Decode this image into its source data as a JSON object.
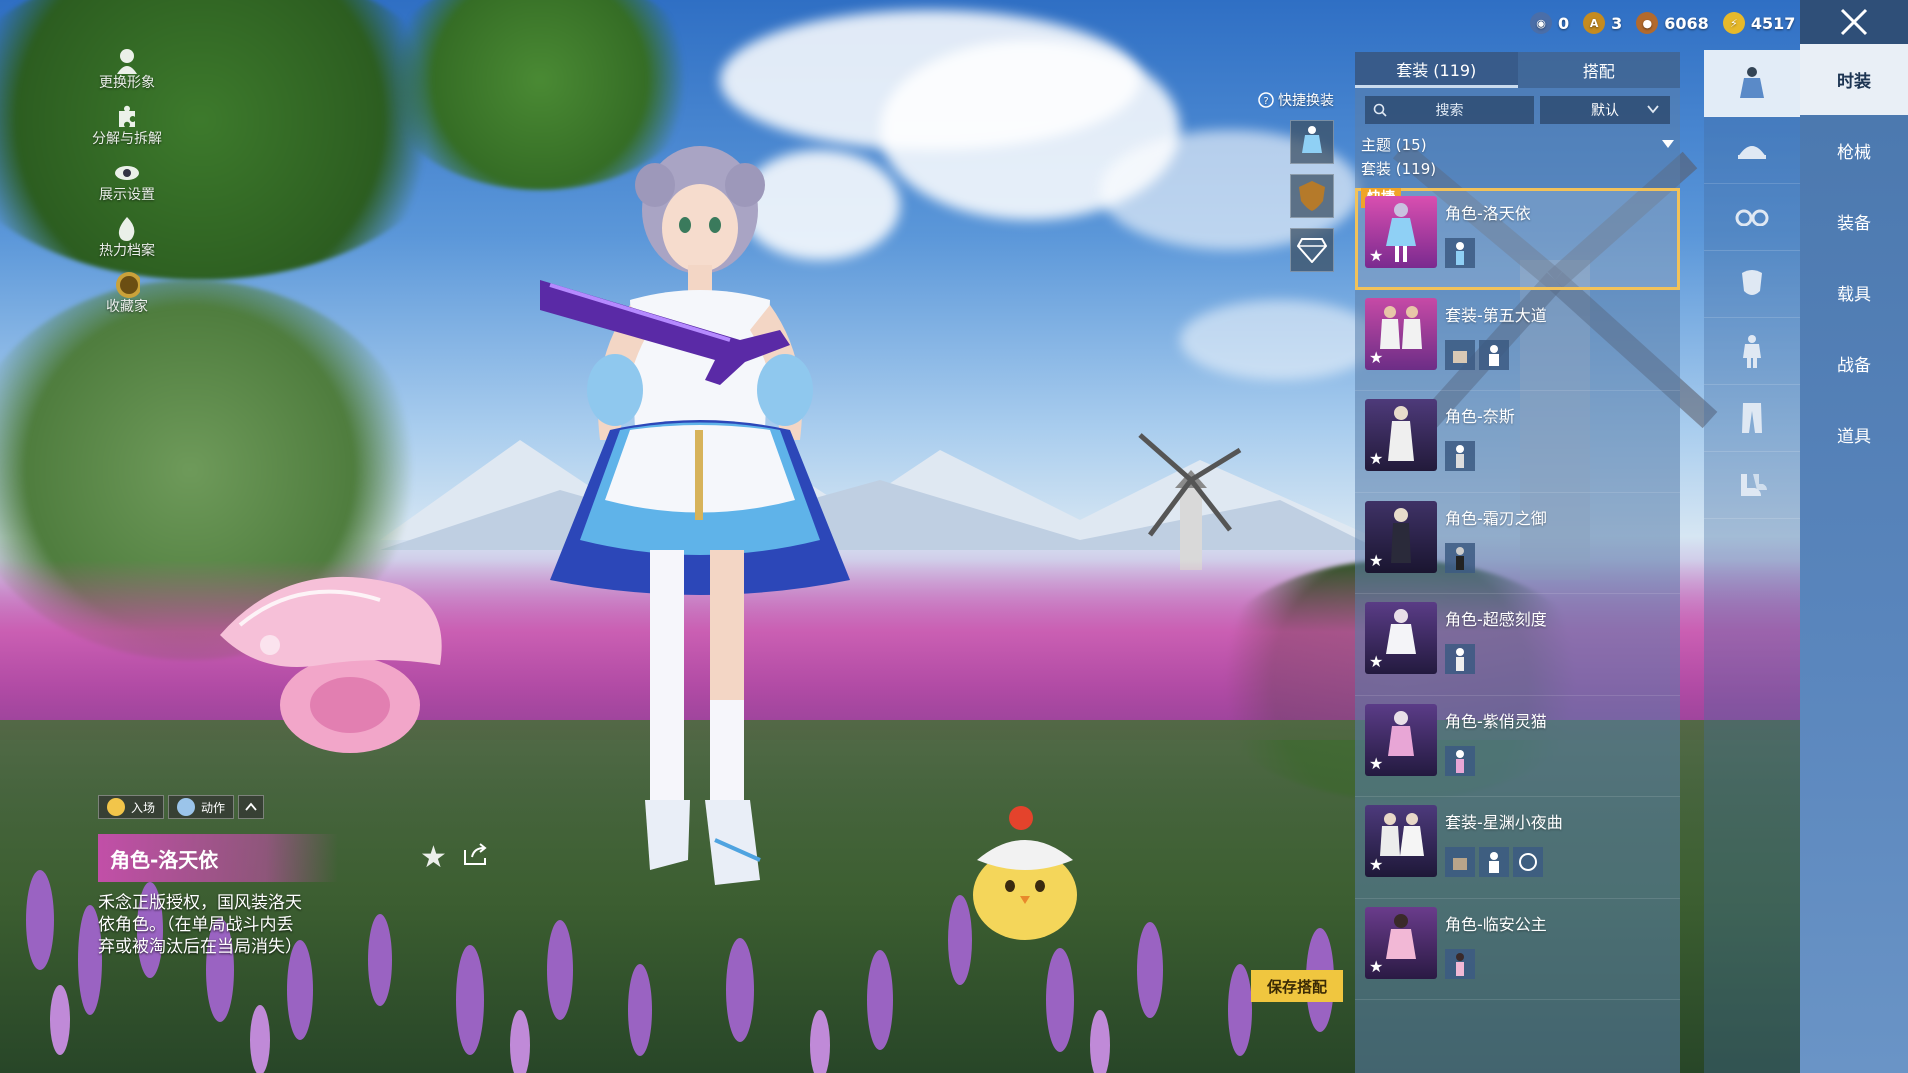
{
  "left_menu": [
    {
      "label": "更换形象",
      "icon": "person-icon"
    },
    {
      "label": "分解与拆解",
      "icon": "puzzle-icon"
    },
    {
      "label": "展示设置",
      "icon": "eye-icon"
    },
    {
      "label": "热力档案",
      "icon": "flame-icon"
    },
    {
      "label": "收藏家",
      "icon": "collector-badge-icon"
    }
  ],
  "currency": [
    {
      "value": "0",
      "icon": "globe-coin-icon",
      "color": "#4a6ea8"
    },
    {
      "value": "3",
      "icon": "a-coin-icon",
      "color": "#c58b1f"
    },
    {
      "value": "6068",
      "icon": "bronze-coin-icon",
      "color": "#b26a2d"
    },
    {
      "value": "4517",
      "icon": "gold-coin-icon",
      "color": "#e7b92a"
    }
  ],
  "categories": [
    "时装",
    "枪械",
    "装备",
    "载具",
    "战备",
    "道具"
  ],
  "slots": [
    "outfit-icon",
    "hat-icon",
    "glasses-icon",
    "mask-icon",
    "body-icon",
    "pants-icon",
    "shoes-icon"
  ],
  "panel": {
    "tab_sets": "套装 (119)",
    "tab_match": "搭配",
    "search_placeholder": "搜索",
    "sort_label": "默认",
    "theme_header": "主题 (15)",
    "set_header": "套装 (119)",
    "quick_badge": "快捷"
  },
  "outfits": [
    {
      "title": "角色-洛天依",
      "subs": 1,
      "color": "#c23f9e"
    },
    {
      "title": "套装-第五大道",
      "subs": 2,
      "color": "#b53d9a"
    },
    {
      "title": "角色-奈斯",
      "subs": 1,
      "color": "#6a3f8c"
    },
    {
      "title": "角色-霜刃之御",
      "subs": 1,
      "color": "#5a3a82"
    },
    {
      "title": "角色-超感刻度",
      "subs": 1,
      "color": "#6b4290"
    },
    {
      "title": "角色-紫俏灵猫",
      "subs": 1,
      "color": "#6c3f8f"
    },
    {
      "title": "套装-星渊小夜曲",
      "subs": 3,
      "color": "#5b3a85"
    },
    {
      "title": "角色-临安公主",
      "subs": 1,
      "color": "#7a3e92"
    }
  ],
  "quick_change": {
    "label": "快捷换装"
  },
  "save_label": "保存搭配",
  "actions": {
    "enter": "入场",
    "motion": "动作"
  },
  "character": {
    "name": "角色-洛天依",
    "description": "禾念正版授权，国风装洛天依角色。（在单局战斗内丢弃或被淘汰后在当局消失）"
  },
  "colors": {
    "accent_pink": "#c24fa8",
    "selected_outline": "#f2c25a",
    "save_yellow": "#f0c63f",
    "nav_bg": "#4a77ad"
  }
}
